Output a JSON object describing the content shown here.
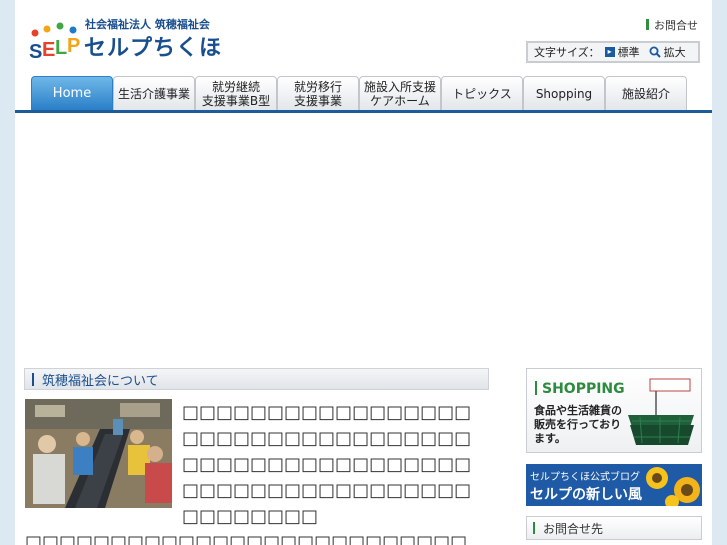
{
  "header": {
    "org_name": "社会福祉法人 筑穂福祉会",
    "brand_name": "セルプちくほ",
    "logo_letters": "SELP",
    "contact_link": "お問合せ",
    "font_size": {
      "label": "文字サイズ：",
      "standard": "標準",
      "large": "拡大"
    }
  },
  "nav": {
    "items": [
      {
        "label": "Home"
      },
      {
        "label": "生活介護事業"
      },
      {
        "label": "就労継続\n支援事業B型"
      },
      {
        "label": "就労移行\n支援事業"
      },
      {
        "label": "施設入所支援\nケアホーム"
      },
      {
        "label": "トピックス"
      },
      {
        "label": "Shopping"
      },
      {
        "label": "施設紹介"
      }
    ]
  },
  "about": {
    "title": "筑穂福祉会について",
    "body": "□□□□□□□□□□□□□□□□□□□□□□□□□□□□□□□□□□□□□□□□□□□□□□□□□□□□□□□□□□□□□□□□□□□□□□□□□□□□",
    "body_continued": "□□□□□□□□□□□□□□□□□□□□□□□□□□"
  },
  "sidebar": {
    "shopping": {
      "title": "SHOPPING",
      "text": "食品や生活雑貨の販売を行っております。"
    },
    "blog": {
      "subtitle": "セルプちくほ公式ブログ",
      "title": "セルプの新しい風"
    },
    "contact": {
      "title": "お問合せ先"
    }
  },
  "colors": {
    "brand_blue": "#1a4f8f",
    "nav_line": "#1c5c9b",
    "active_tab": "#2a7fc8",
    "shop_green": "#2d8a3e"
  }
}
